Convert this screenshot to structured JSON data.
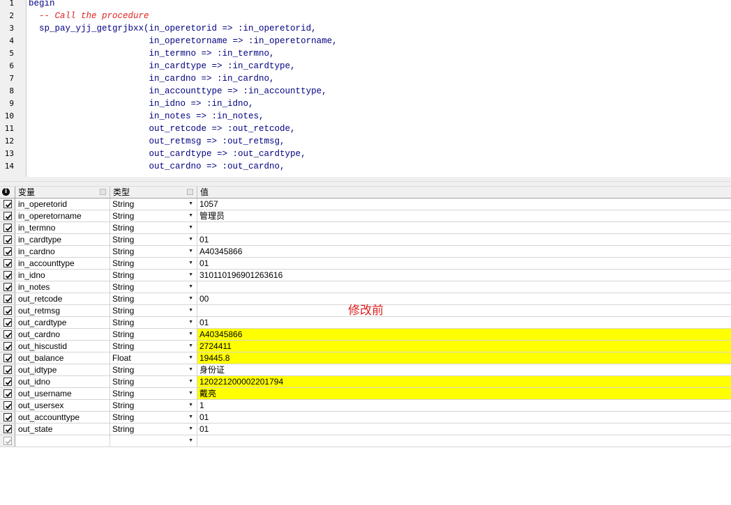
{
  "editor": {
    "line_numbers": [
      "1",
      "2",
      "3",
      "4",
      "5",
      "6",
      "7",
      "8",
      "9",
      "10",
      "11",
      "12",
      "13",
      "14"
    ],
    "lines": [
      {
        "text": "begin",
        "style": "code"
      },
      {
        "text": "  -- Call the procedure",
        "style": "comment"
      },
      {
        "text": "  sp_pay_yjj_getgrjbxx(in_operetorid => :in_operetorid,",
        "style": "code"
      },
      {
        "text": "                       in_operetorname => :in_operetorname,",
        "style": "code"
      },
      {
        "text": "                       in_termno => :in_termno,",
        "style": "code"
      },
      {
        "text": "                       in_cardtype => :in_cardtype,",
        "style": "code"
      },
      {
        "text": "                       in_cardno => :in_cardno,",
        "style": "code"
      },
      {
        "text": "                       in_accounttype => :in_accounttype,",
        "style": "code"
      },
      {
        "text": "                       in_idno => :in_idno,",
        "style": "code"
      },
      {
        "text": "                       in_notes => :in_notes,",
        "style": "code"
      },
      {
        "text": "                       out_retcode => :out_retcode,",
        "style": "code"
      },
      {
        "text": "                       out_retmsg => :out_retmsg,",
        "style": "code"
      },
      {
        "text": "                       out_cardtype => :out_cardtype,",
        "style": "code"
      },
      {
        "text": "                       out_cardno => :out_cardno,",
        "style": "code"
      }
    ]
  },
  "grid": {
    "header_icon": "info-icon",
    "columns": {
      "variable": "变量",
      "type": "类型",
      "value": "值"
    },
    "rows": [
      {
        "name": "in_operetorid",
        "type": "String",
        "value": "1057",
        "highlight": false
      },
      {
        "name": "in_operetorname",
        "type": "String",
        "value": "管理员",
        "highlight": false
      },
      {
        "name": "in_termno",
        "type": "String",
        "value": "",
        "highlight": false
      },
      {
        "name": "in_cardtype",
        "type": "String",
        "value": "01",
        "highlight": false
      },
      {
        "name": "in_cardno",
        "type": "String",
        "value": "A40345866",
        "highlight": false
      },
      {
        "name": "in_accounttype",
        "type": "String",
        "value": "01",
        "highlight": false
      },
      {
        "name": "in_idno",
        "type": "String",
        "value": "310110196901263616",
        "highlight": false
      },
      {
        "name": "in_notes",
        "type": "String",
        "value": "",
        "highlight": false
      },
      {
        "name": "out_retcode",
        "type": "String",
        "value": "00",
        "highlight": false
      },
      {
        "name": "out_retmsg",
        "type": "String",
        "value": "",
        "highlight": false
      },
      {
        "name": "out_cardtype",
        "type": "String",
        "value": "01",
        "highlight": false
      },
      {
        "name": "out_cardno",
        "type": "String",
        "value": "A40345866",
        "highlight": true
      },
      {
        "name": "out_hiscustid",
        "type": "String",
        "value": "2724411",
        "highlight": true
      },
      {
        "name": "out_balance",
        "type": "Float",
        "value": "19445.8",
        "highlight": true
      },
      {
        "name": "out_idtype",
        "type": "String",
        "value": "身份证",
        "highlight": false
      },
      {
        "name": "out_idno",
        "type": "String",
        "value": "120221200002201794",
        "highlight": true
      },
      {
        "name": "out_username",
        "type": "String",
        "value": "戴亮",
        "highlight": true
      },
      {
        "name": "out_usersex",
        "type": "String",
        "value": "1",
        "highlight": false
      },
      {
        "name": "out_accounttype",
        "type": "String",
        "value": "01",
        "highlight": false
      },
      {
        "name": "out_state",
        "type": "String",
        "value": "01",
        "highlight": false
      }
    ],
    "highlight_color": "#ffff00"
  },
  "annotation": {
    "text": "修改前",
    "color": "#e02020"
  }
}
